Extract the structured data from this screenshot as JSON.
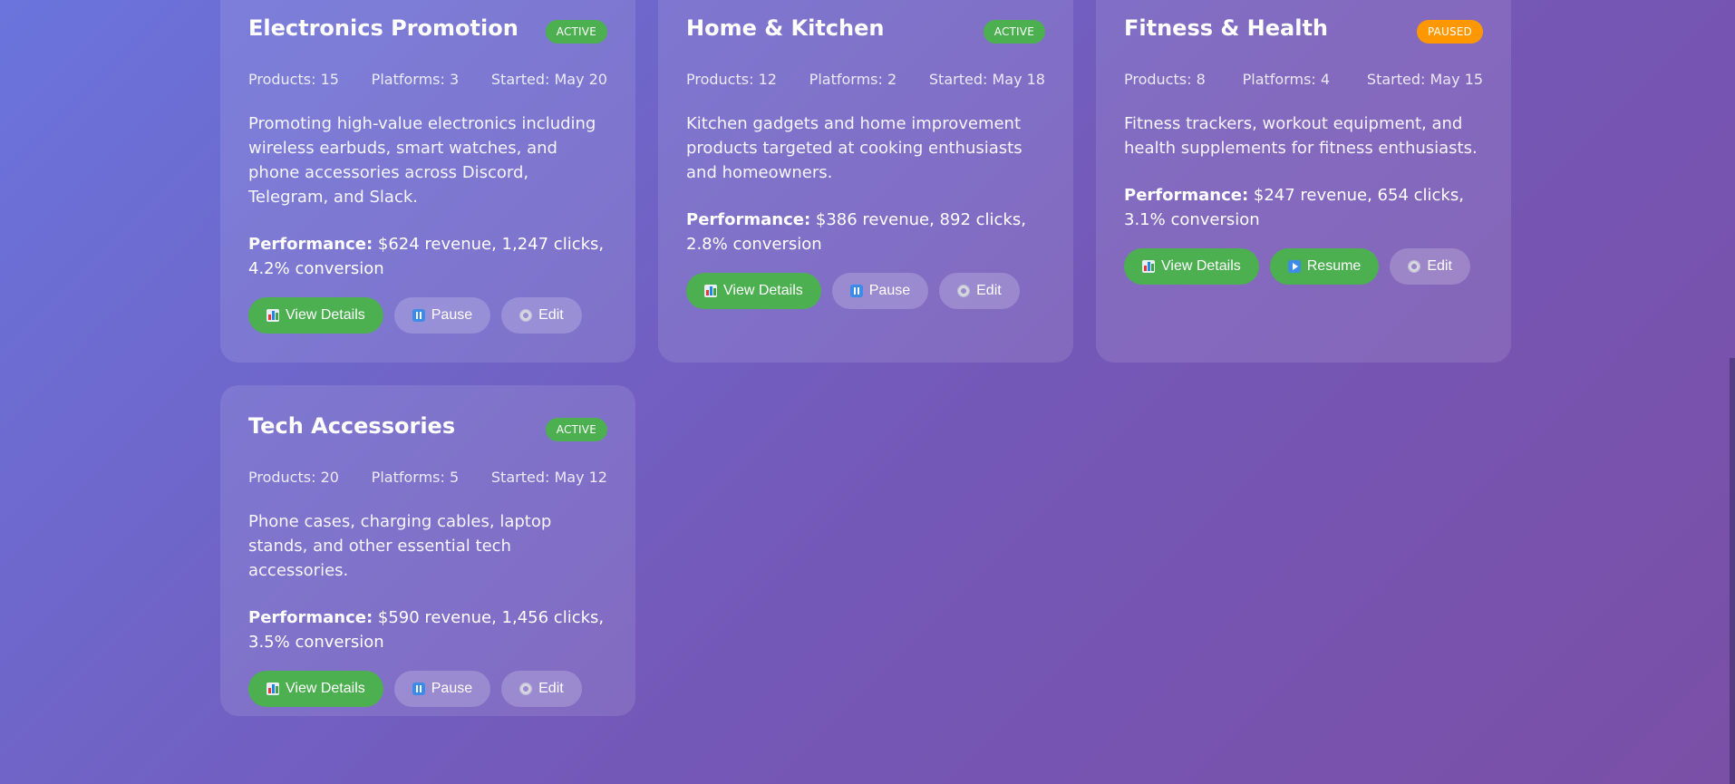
{
  "campaigns": [
    {
      "title": "Electronics Promotion",
      "status": "ACTIVE",
      "products": "Products: 15",
      "platforms": "Platforms: 3",
      "started": "Started: May 20",
      "description": "Promoting high-value electronics including wireless earbuds, smart watches, and phone accessories across Discord, Telegram, and Slack.",
      "performance_label": "Performance:",
      "performance_text": " $624 revenue, 1,247 clicks, 4.2% conversion",
      "buttons": {
        "details": "View Details",
        "toggle": "Pause",
        "edit": "Edit"
      }
    },
    {
      "title": "Home & Kitchen",
      "status": "ACTIVE",
      "products": "Products: 12",
      "platforms": "Platforms: 2",
      "started": "Started: May 18",
      "description": "Kitchen gadgets and home improvement products targeted at cooking enthusiasts and homeowners.",
      "performance_label": "Performance:",
      "performance_text": " $386 revenue, 892 clicks, 2.8% conversion",
      "buttons": {
        "details": "View Details",
        "toggle": "Pause",
        "edit": "Edit"
      }
    },
    {
      "title": "Fitness & Health",
      "status": "PAUSED",
      "products": "Products: 8",
      "platforms": "Platforms: 4",
      "started": "Started: May 15",
      "description": "Fitness trackers, workout equipment, and health supplements for fitness enthusiasts.",
      "performance_label": "Performance:",
      "performance_text": " $247 revenue, 654 clicks, 3.1% conversion",
      "buttons": {
        "details": "View Details",
        "toggle": "Resume",
        "edit": "Edit"
      }
    },
    {
      "title": "Tech Accessories",
      "status": "ACTIVE",
      "products": "Products: 20",
      "platforms": "Platforms: 5",
      "started": "Started: May 12",
      "description": "Phone cases, charging cables, laptop stands, and other essential tech accessories.",
      "performance_label": "Performance:",
      "performance_text": " $590 revenue, 1,456 clicks, 3.5% conversion",
      "buttons": {
        "details": "View Details",
        "toggle": "Pause",
        "edit": "Edit"
      }
    }
  ],
  "icons": {
    "details": "bar-chart-icon",
    "pause": "pause-icon",
    "resume": "play-icon",
    "edit": "gear-icon"
  },
  "colors": {
    "active": "#4caf50",
    "paused": "#ff9800",
    "background_start": "#6a74dc",
    "background_end": "#7a4fa6"
  }
}
